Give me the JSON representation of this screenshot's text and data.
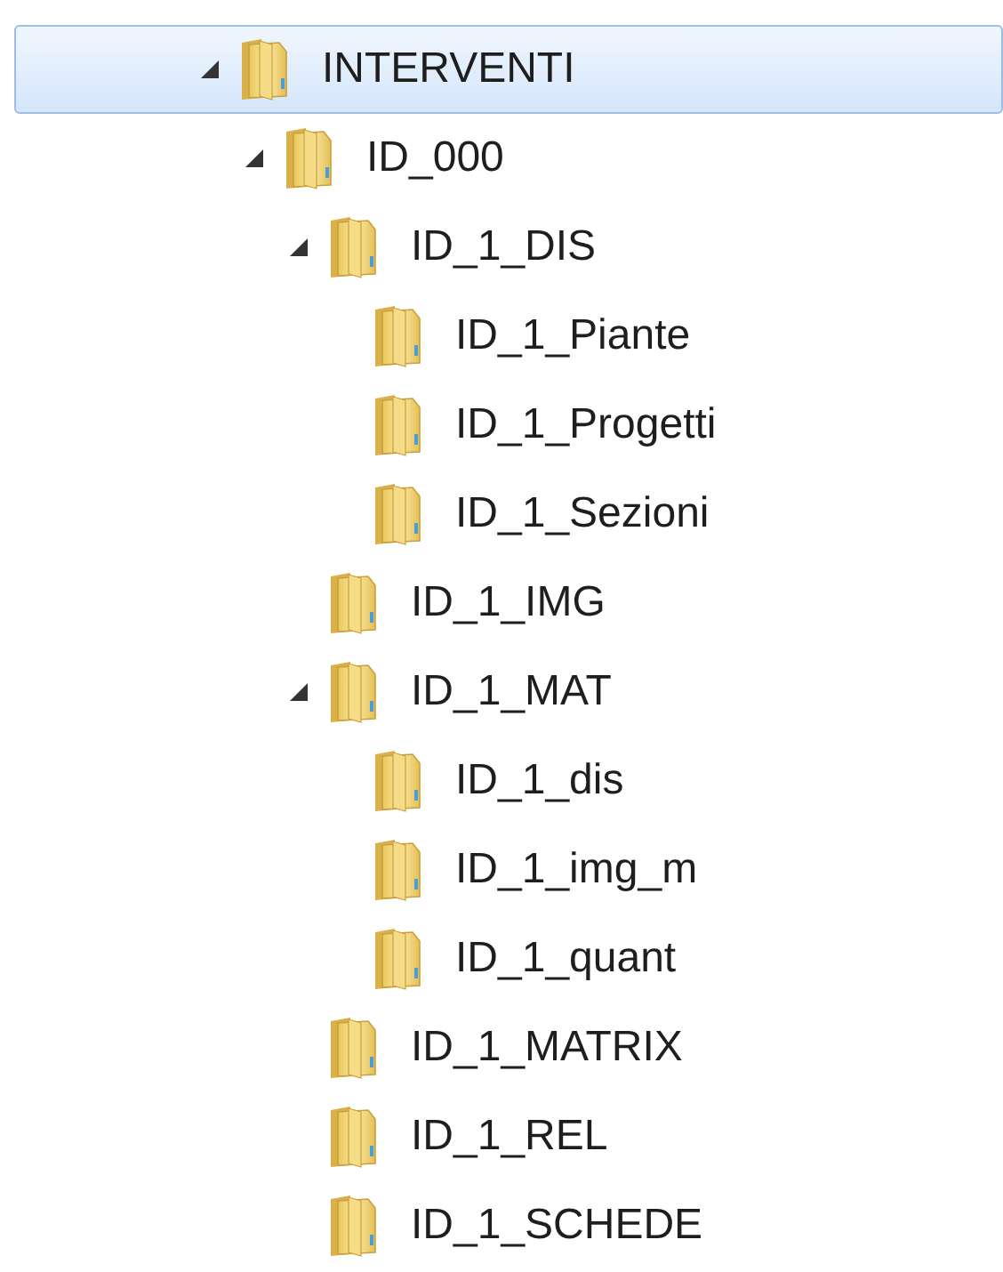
{
  "tree": [
    {
      "name": "INTERVENTI",
      "selected": true,
      "expanded": true,
      "children": [
        {
          "name": "ID_000",
          "selected": false,
          "expanded": true,
          "children": [
            {
              "name": "ID_1_DIS",
              "selected": false,
              "expanded": true,
              "children": [
                {
                  "name": "ID_1_Piante",
                  "selected": false
                },
                {
                  "name": "ID_1_Progetti",
                  "selected": false
                },
                {
                  "name": "ID_1_Sezioni",
                  "selected": false
                }
              ]
            },
            {
              "name": "ID_1_IMG",
              "selected": false
            },
            {
              "name": "ID_1_MAT",
              "selected": false,
              "expanded": true,
              "children": [
                {
                  "name": "ID_1_dis",
                  "selected": false
                },
                {
                  "name": "ID_1_img_m",
                  "selected": false
                },
                {
                  "name": "ID_1_quant",
                  "selected": false
                }
              ]
            },
            {
              "name": "ID_1_MATRIX",
              "selected": false
            },
            {
              "name": "ID_1_REL",
              "selected": false
            },
            {
              "name": "ID_1_SCHEDE",
              "selected": false
            }
          ]
        }
      ]
    }
  ]
}
